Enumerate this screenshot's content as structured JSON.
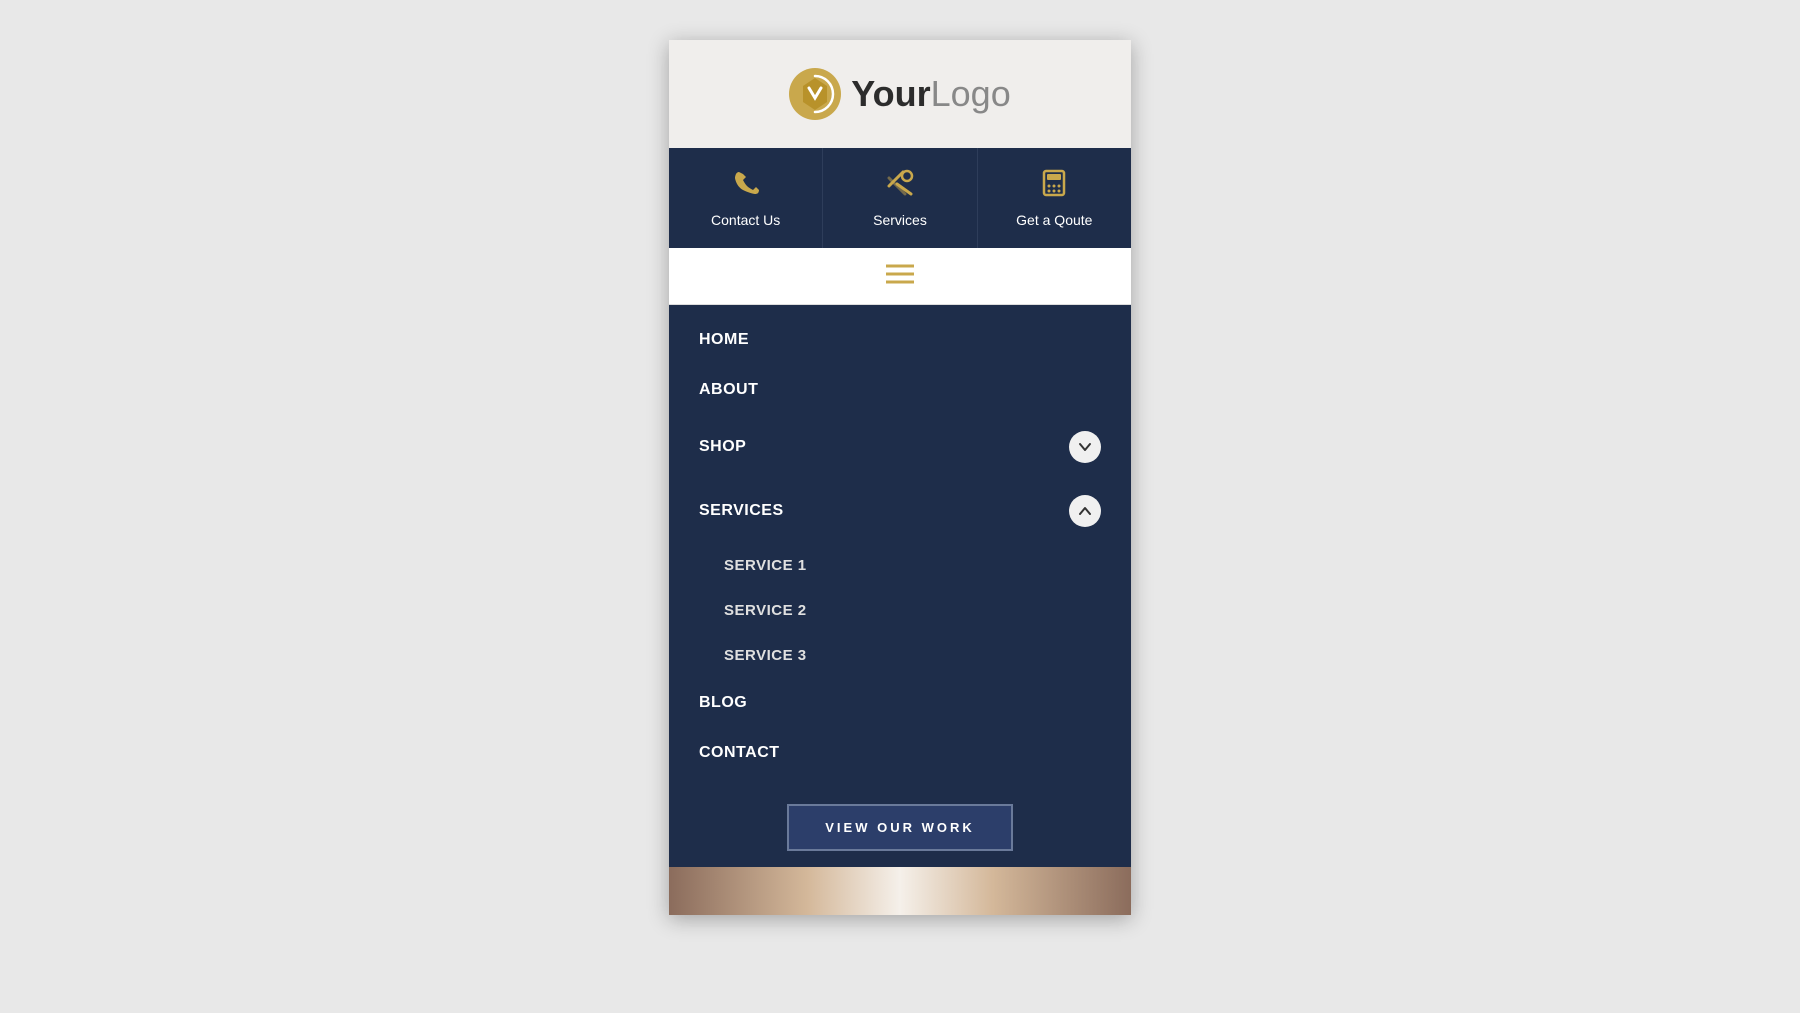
{
  "header": {
    "logo_your": "Your",
    "logo_logo": "Logo"
  },
  "top_nav": {
    "items": [
      {
        "id": "contact-us",
        "label": "Contact Us",
        "icon": "phone"
      },
      {
        "id": "services",
        "label": "Services",
        "icon": "wrench"
      },
      {
        "id": "get-a-quote",
        "label": "Get a Qoute",
        "icon": "calculator"
      }
    ]
  },
  "main_nav": {
    "items": [
      {
        "id": "home",
        "label": "HOME",
        "has_dropdown": false,
        "dropdown_open": false
      },
      {
        "id": "about",
        "label": "ABOUT",
        "has_dropdown": false,
        "dropdown_open": false
      },
      {
        "id": "shop",
        "label": "SHOP",
        "has_dropdown": true,
        "dropdown_open": false
      },
      {
        "id": "services",
        "label": "SERVICES",
        "has_dropdown": true,
        "dropdown_open": true
      },
      {
        "id": "service-1",
        "label": "SERVICE 1",
        "is_sub": true
      },
      {
        "id": "service-2",
        "label": "SERVICE 2",
        "is_sub": true
      },
      {
        "id": "service-3",
        "label": "SERVICE 3",
        "is_sub": true
      },
      {
        "id": "blog",
        "label": "BLOG",
        "has_dropdown": false,
        "dropdown_open": false
      },
      {
        "id": "contact",
        "label": "CONTACT",
        "has_dropdown": false,
        "dropdown_open": false
      }
    ]
  },
  "cta": {
    "label": "VIEW OUR WORK"
  },
  "colors": {
    "navy": "#1e2d4a",
    "gold": "#c9a84c",
    "white": "#ffffff",
    "bg": "#f0eeec"
  }
}
